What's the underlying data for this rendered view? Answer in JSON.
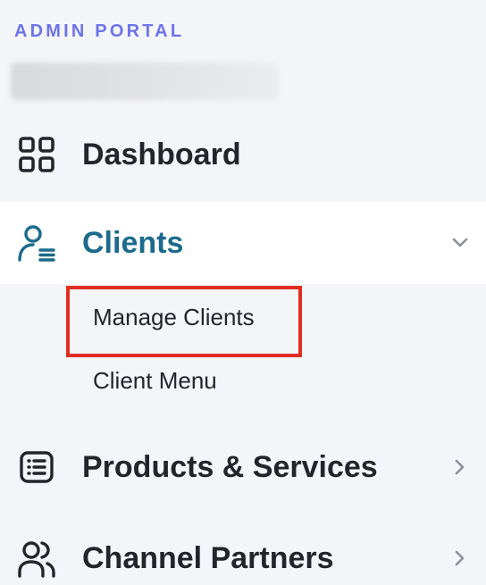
{
  "sidebar": {
    "portal_title": "ADMIN PORTAL",
    "nav": {
      "dashboard": {
        "label": "Dashboard",
        "icon": "dashboard-grid-icon"
      },
      "clients": {
        "label": "Clients",
        "icon": "user-list-icon",
        "expanded": true,
        "sub_items": [
          {
            "label": "Manage Clients"
          },
          {
            "label": "Client Menu"
          }
        ]
      },
      "products": {
        "label": "Products & Services",
        "icon": "list-box-icon"
      },
      "partners": {
        "label": "Channel Partners",
        "icon": "users-icon"
      }
    }
  },
  "colors": {
    "accent": "#6d74e8",
    "active_text": "#1b6a8c",
    "highlight": "#e02d22",
    "background": "#f4f5f9",
    "active_background": "#ffffff"
  }
}
